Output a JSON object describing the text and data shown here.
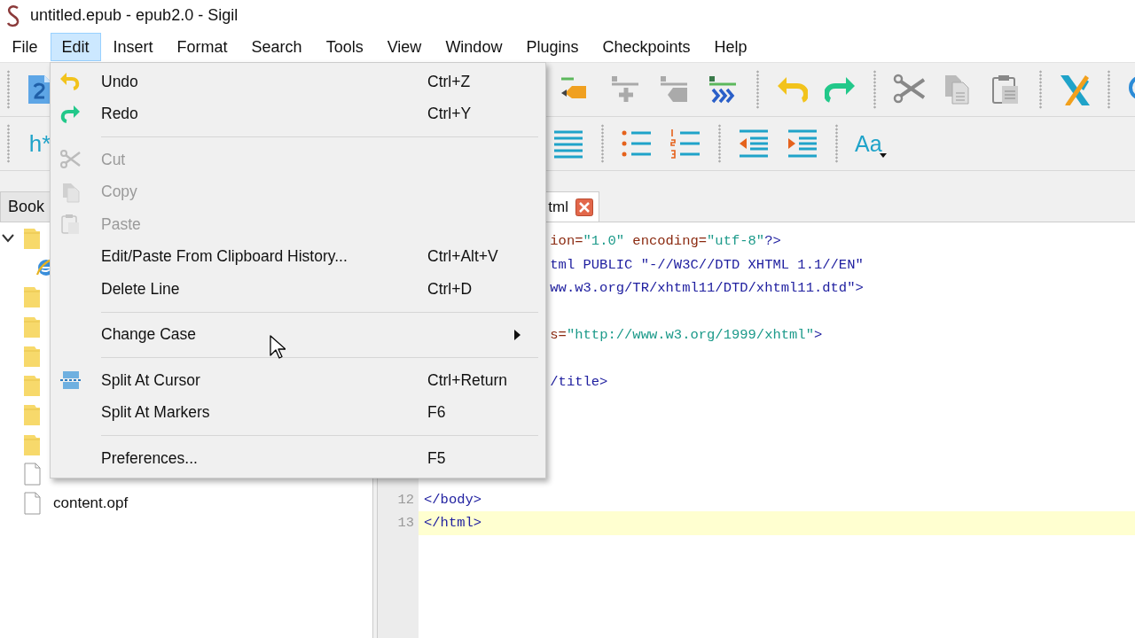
{
  "window": {
    "title": "untitled.epub - epub2.0 - Sigil"
  },
  "menu_bar": [
    {
      "label": "File",
      "selected": false
    },
    {
      "label": "Edit",
      "selected": true
    },
    {
      "label": "Insert",
      "selected": false
    },
    {
      "label": "Format",
      "selected": false
    },
    {
      "label": "Search",
      "selected": false
    },
    {
      "label": "Tools",
      "selected": false
    },
    {
      "label": "View",
      "selected": false
    },
    {
      "label": "Window",
      "selected": false
    },
    {
      "label": "Plugins",
      "selected": false
    },
    {
      "label": "Checkpoints",
      "selected": false
    },
    {
      "label": "Help",
      "selected": false
    }
  ],
  "toolbar": {
    "heading_button": "h*",
    "case_button": "Aa"
  },
  "book_browser": {
    "tab": "Book",
    "items": [
      {
        "kind": "folder",
        "expanded": true,
        "children": [
          {
            "kind": "web"
          }
        ]
      },
      {
        "kind": "folder"
      },
      {
        "kind": "folder"
      },
      {
        "kind": "folder"
      },
      {
        "kind": "folder"
      },
      {
        "kind": "folder"
      },
      {
        "kind": "folder"
      },
      {
        "kind": "file"
      },
      {
        "kind": "file",
        "name": "content.opf"
      }
    ]
  },
  "editor": {
    "tab": {
      "label": "tml",
      "closable": true
    },
    "lines": [
      {
        "kind": "partial",
        "current": false,
        "tokens": [
          {
            "kind": "attr",
            "text": "ion="
          },
          {
            "kind": "value",
            "text": "\"1.0\""
          },
          {
            "kind": "attr",
            "text": " encoding="
          },
          {
            "kind": "value",
            "text": "\"utf-8\""
          },
          {
            "kind": "tag",
            "text": "?>"
          }
        ]
      },
      {
        "kind": "partial",
        "current": false,
        "tokens": [
          {
            "kind": "tag",
            "text": "tml PUBLIC \"-//W3C//DTD XHTML 1.1//EN\""
          }
        ]
      },
      {
        "kind": "partial",
        "current": false,
        "tokens": [
          {
            "kind": "tag",
            "text": "ww.w3.org/TR/xhtml11/DTD/xhtml11.dtd\">"
          }
        ]
      },
      {
        "kind": "blank"
      },
      {
        "kind": "partial",
        "current": false,
        "tokens": [
          {
            "kind": "attr",
            "text": "s="
          },
          {
            "kind": "value",
            "text": "\"http://www.w3.org/1999/xhtml\""
          },
          {
            "kind": "tag",
            "text": ">"
          }
        ]
      },
      {
        "kind": "blank"
      },
      {
        "kind": "partial",
        "current": false,
        "tokens": [
          {
            "kind": "tag",
            "text": "/title>"
          }
        ]
      },
      {
        "kind": "blank"
      },
      {
        "kind": "blank"
      },
      {
        "kind": "blank"
      },
      {
        "kind": "blank"
      },
      {
        "kind": "full",
        "number": "12",
        "current": false,
        "tokens": [
          {
            "kind": "tag",
            "text": "</body>"
          }
        ]
      },
      {
        "kind": "full",
        "number": "13",
        "current": true,
        "tokens": [
          {
            "kind": "tag",
            "text": "</html>"
          }
        ]
      }
    ]
  },
  "edit_menu": {
    "items": [
      {
        "kind": "item",
        "label": "Undo",
        "shortcut": "Ctrl+Z",
        "disabled": false
      },
      {
        "kind": "item",
        "label": "Redo",
        "shortcut": "Ctrl+Y",
        "disabled": false
      },
      {
        "kind": "separator"
      },
      {
        "kind": "item",
        "label": "Cut",
        "disabled": true
      },
      {
        "kind": "item",
        "label": "Copy",
        "disabled": true
      },
      {
        "kind": "item",
        "label": "Paste",
        "disabled": true
      },
      {
        "kind": "item",
        "label": "Edit/Paste From Clipboard History...",
        "shortcut": "Ctrl+Alt+V",
        "disabled": false
      },
      {
        "kind": "item",
        "label": "Delete Line",
        "shortcut": "Ctrl+D",
        "disabled": false
      },
      {
        "kind": "separator"
      },
      {
        "kind": "submenu",
        "label": "Change Case",
        "disabled": false
      },
      {
        "kind": "separator"
      },
      {
        "kind": "item",
        "label": "Split At Cursor",
        "shortcut": "Ctrl+Return",
        "disabled": false
      },
      {
        "kind": "item",
        "label": "Split At Markers",
        "shortcut": "F6",
        "disabled": false
      },
      {
        "kind": "separator"
      },
      {
        "kind": "item",
        "label": "Preferences...",
        "shortcut": "F5",
        "disabled": false
      }
    ]
  }
}
